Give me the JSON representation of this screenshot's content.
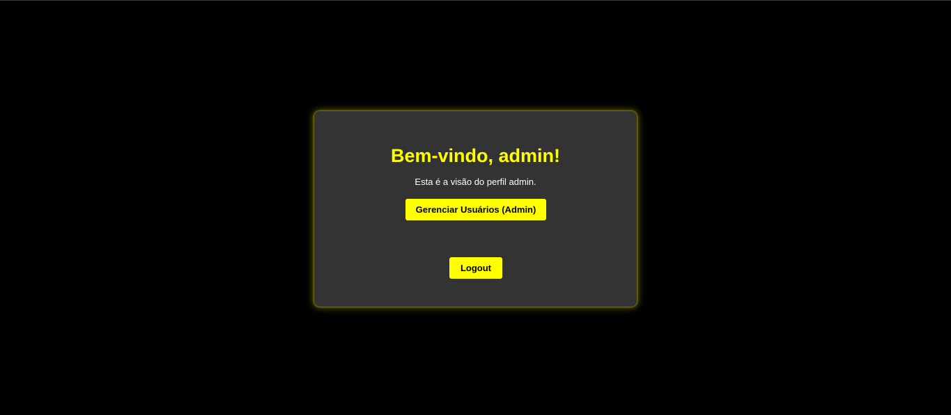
{
  "colors": {
    "background": "#000000",
    "card": "#333333",
    "accent": "#ffff00",
    "text": "#ffffff",
    "button_text": "#000000"
  },
  "welcome": {
    "title": "Bem-vindo, admin!",
    "subtitle": "Esta é a visão do perfil admin."
  },
  "actions": {
    "admin_button_label": "Gerenciar Usuários (Admin)",
    "logout_label": "Logout"
  }
}
